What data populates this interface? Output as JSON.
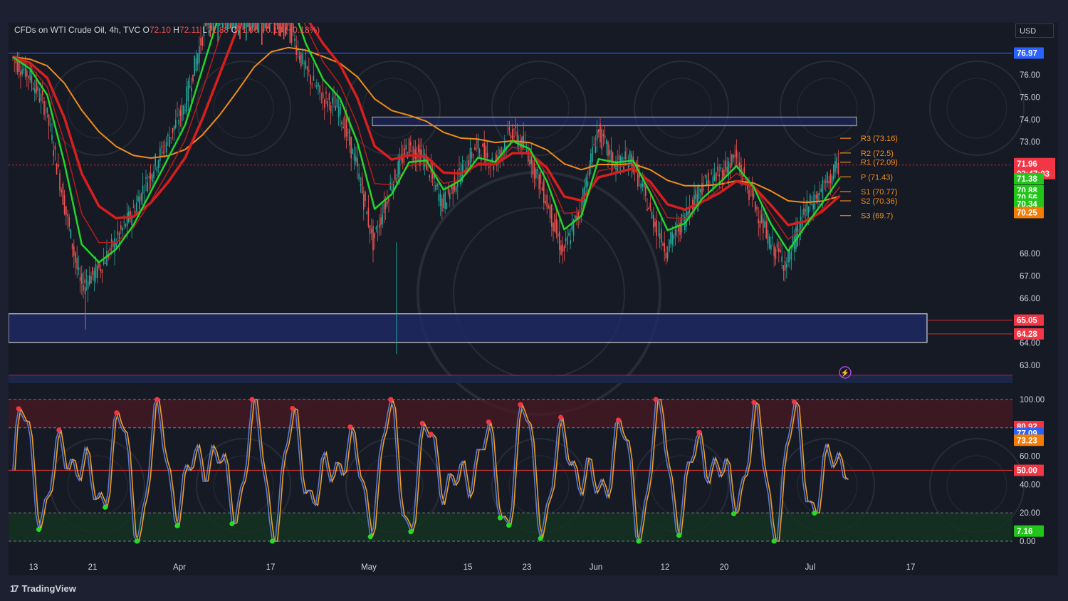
{
  "header": {
    "symbol": "CFDs on WTI Crude Oil, 4h, TVC",
    "o_label": "O",
    "o_value": "72.10",
    "h_label": "H",
    "h_value": "72.11",
    "l_label": "L",
    "l_value": "71.88",
    "c_label": "C",
    "c_value": "71.96",
    "change": "−0.13 (−0.18%)"
  },
  "currency": "USD",
  "brand": {
    "logo": "17",
    "name": "TradingView"
  },
  "colors": {
    "background": "#161a25",
    "up": "#26a69a",
    "down": "#ef5350",
    "ma_red": "#d81e1e",
    "ma_green": "#22d62a",
    "ma_orange": "#f08c1a",
    "zone_fill": "#1e2a6b",
    "stoch_k": "#5b7ad6",
    "stoch_d": "#f0a020"
  },
  "chart_data": [
    {
      "type": "line",
      "description_source": "price panel",
      "y_axis_ticks": [
        "76.00",
        "75.00",
        "74.00",
        "73.00",
        "68.00",
        "67.00",
        "66.00",
        "64.00",
        "63.00"
      ],
      "ylim": [
        62.6,
        77.2
      ],
      "x_ticks": [
        "13",
        "21",
        "Apr",
        "17",
        "May",
        "15",
        "23",
        "Jun",
        "12",
        "20",
        "Jul",
        "17"
      ],
      "price_labels": [
        {
          "value": "76.97",
          "color": "#2962ff"
        },
        {
          "value": "71.96",
          "color": "#f23645"
        },
        {
          "value": "03:47:03",
          "color": "#f23645"
        },
        {
          "value": "71.38",
          "color": "#22c51a"
        },
        {
          "value": "70.88",
          "color": "#22c51a"
        },
        {
          "value": "70.56",
          "color": "#22c51a"
        },
        {
          "value": "70.34",
          "color": "#22c51a"
        },
        {
          "value": "70.25",
          "color": "#f57c00"
        },
        {
          "value": "65.05",
          "color": "#f23645"
        },
        {
          "value": "64.28",
          "color": "#f23645"
        }
      ],
      "pivots": [
        {
          "label": "R3 (73.16)",
          "value": 73.16
        },
        {
          "label": "R2 (72.5)",
          "value": 72.5
        },
        {
          "label": "R1 (72.09)",
          "value": 72.09
        },
        {
          "label": "P (71.43)",
          "value": 71.43
        },
        {
          "label": "S1 (70.77)",
          "value": 70.77
        },
        {
          "label": "S2 (70.36)",
          "value": 70.36
        },
        {
          "label": "S3 (69.7)",
          "value": 69.7
        }
      ],
      "zones": [
        {
          "name": "resistance",
          "from": 73.5,
          "to": 73.85
        },
        {
          "name": "support",
          "from": 64.28,
          "to": 65.05
        }
      ],
      "horizontal_lines": [
        {
          "value": 76.97
        },
        {
          "value": 62.6
        }
      ],
      "close_series": [
        {
          "t": "Mar 11",
          "c": 76.8
        },
        {
          "t": "Mar 13",
          "c": 76.0
        },
        {
          "t": "Mar 15",
          "c": 74.5
        },
        {
          "t": "Mar 17",
          "c": 70.5
        },
        {
          "t": "Mar 19",
          "c": 66.6
        },
        {
          "t": "Mar 21",
          "c": 67.2
        },
        {
          "t": "Mar 23",
          "c": 68.5
        },
        {
          "t": "Mar 25",
          "c": 69.8
        },
        {
          "t": "Mar 27",
          "c": 71.5
        },
        {
          "t": "Mar 29",
          "c": 73.0
        },
        {
          "t": "Apr 1",
          "c": 74.5
        },
        {
          "t": "Apr 4",
          "c": 77.5
        },
        {
          "t": "Apr 8",
          "c": 80.0
        },
        {
          "t": "Apr 12",
          "c": 82.0
        },
        {
          "t": "Apr 16",
          "c": 83.5
        },
        {
          "t": "Apr 20",
          "c": 81.5
        },
        {
          "t": "Apr 24",
          "c": 78.5
        },
        {
          "t": "Apr 27",
          "c": 76.3
        },
        {
          "t": "Apr 29",
          "c": 75.0
        },
        {
          "t": "May 1",
          "c": 74.5
        },
        {
          "t": "May 3",
          "c": 72.0
        },
        {
          "t": "May 6",
          "c": 68.5
        },
        {
          "t": "May 8",
          "c": 71.0
        },
        {
          "t": "May 10",
          "c": 72.8
        },
        {
          "t": "May 13",
          "c": 72.2
        },
        {
          "t": "May 15",
          "c": 70.2
        },
        {
          "t": "May 17",
          "c": 71.5
        },
        {
          "t": "May 20",
          "c": 72.8
        },
        {
          "t": "May 22",
          "c": 72.0
        },
        {
          "t": "May 24",
          "c": 73.5
        },
        {
          "t": "May 27",
          "c": 72.5
        },
        {
          "t": "May 29",
          "c": 70.5
        },
        {
          "t": "May 31",
          "c": 68.0
        },
        {
          "t": "Jun 3",
          "c": 70.0
        },
        {
          "t": "Jun 4",
          "c": 73.5
        },
        {
          "t": "Jun 6",
          "c": 72.0
        },
        {
          "t": "Jun 8",
          "c": 72.2
        },
        {
          "t": "Jun 10",
          "c": 70.0
        },
        {
          "t": "Jun 12",
          "c": 68.2
        },
        {
          "t": "Jun 14",
          "c": 69.5
        },
        {
          "t": "Jun 17",
          "c": 71.0
        },
        {
          "t": "Jun 19",
          "c": 71.5
        },
        {
          "t": "Jun 21",
          "c": 72.3
        },
        {
          "t": "Jun 24",
          "c": 70.5
        },
        {
          "t": "Jun 26",
          "c": 68.5
        },
        {
          "t": "Jun 28",
          "c": 67.5
        },
        {
          "t": "Jul 1",
          "c": 69.8
        },
        {
          "t": "Jul 3",
          "c": 70.8
        },
        {
          "t": "Jul 5",
          "c": 71.96
        }
      ]
    },
    {
      "type": "line",
      "description_source": "stochastic oscillator panel",
      "y_axis_ticks": [
        "100.00",
        "60.00",
        "40.00",
        "20.00",
        "0.00"
      ],
      "ylim": [
        0,
        100
      ],
      "levels": [
        80,
        50,
        20
      ],
      "value_labels": [
        {
          "value": "80.92",
          "color": "#f23645"
        },
        {
          "value": "77.09",
          "color": "#2962ff"
        },
        {
          "value": "73.23",
          "color": "#f57c00"
        },
        {
          "value": "50.00",
          "color": "#f23645"
        },
        {
          "value": "7.16",
          "color": "#22c51a"
        }
      ]
    }
  ]
}
